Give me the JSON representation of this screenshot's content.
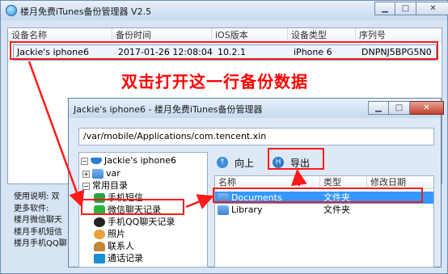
{
  "main_window": {
    "title": "楼月免费iTunes备份管理器 V2.5",
    "controls": {
      "minimize": "▁",
      "maximize": "□",
      "close": "✕"
    },
    "columns": [
      "设备名称",
      "备份时间",
      "iOS版本",
      "设备类型",
      "序列号"
    ],
    "rows": [
      {
        "device_name": "Jackie's iphone6",
        "backup_time": "2017-01-26 12:08:04",
        "ios_version": "10.2.1",
        "device_type": "iPhone 6",
        "serial": "DNPNJ5BPG5N0"
      }
    ]
  },
  "annotation": {
    "text": "双击打开这一行备份数据",
    "color": "#ff0000"
  },
  "help_lines": [
    "使用说明: 双",
    "更多软件:",
    "楼月微信聊天",
    "楼月手机短信",
    "楼月手机QQ聊"
  ],
  "dialog": {
    "title": "Jackie's iphone6 - 楼月免费iTunes备份管理器",
    "path": "/var/mobile/Applications/com.tencent.xin",
    "controls": {
      "minimize": "▁",
      "maximize": "□",
      "close": "✕"
    },
    "tree": {
      "root": "Jackie's iphone6",
      "var": "var",
      "common": "常用目录",
      "items": {
        "sms": "手机短信",
        "wechat": "微信聊天记录",
        "qq": "手机QQ聊天记录",
        "photos": "照片",
        "contacts": "联系人",
        "calls": "通话记录"
      }
    },
    "toolbar": {
      "up": "向上",
      "export": "导出"
    },
    "file_columns": [
      "名称",
      "类型",
      "修改日期"
    ],
    "files": [
      {
        "name": "Documents",
        "type": "文件夹",
        "selected": true
      },
      {
        "name": "Library",
        "type": "文件夹",
        "selected": false
      }
    ]
  },
  "colors": {
    "annotation_red": "#ff1a1a",
    "selection_blue": "#3399ff",
    "window_frame": "#d6e4f3"
  }
}
